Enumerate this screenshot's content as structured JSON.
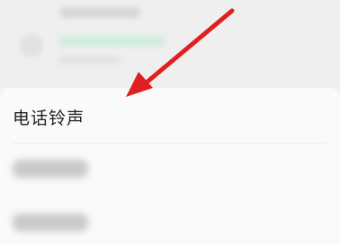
{
  "settings": {
    "items": [
      {
        "label": "电话铃声"
      }
    ]
  },
  "annotation": {
    "arrow_color": "#e02020"
  }
}
